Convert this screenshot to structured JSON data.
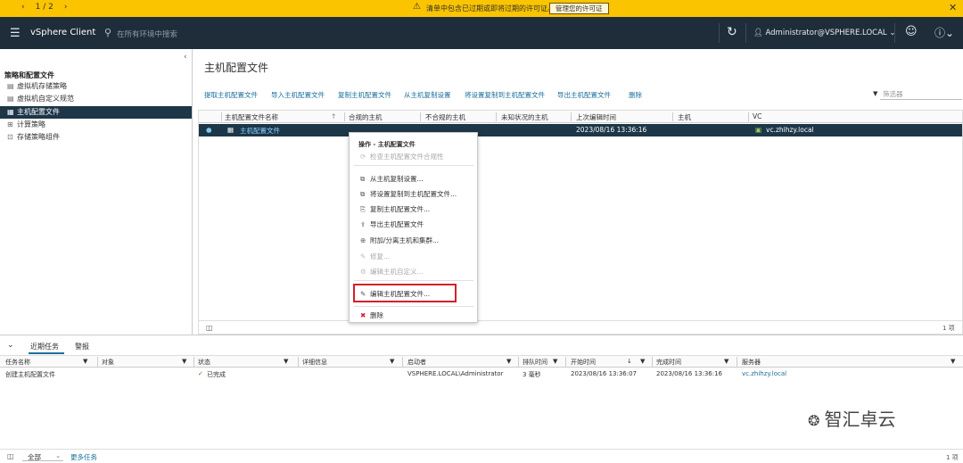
{
  "banner": {
    "pager": "1 / 2",
    "message": "清单中包含已过期或即将过期的许可证。",
    "manage_button": "管理您的许可证",
    "close": "✕"
  },
  "header": {
    "brand": "vSphere Client",
    "search_placeholder": "在所有环境中搜索",
    "user": "Administrator@VSPHERE.LOCAL"
  },
  "leftnav": {
    "section": "策略和配置文件",
    "items": [
      {
        "label": "虚拟机存储策略"
      },
      {
        "label": "虚拟机自定义规范"
      },
      {
        "label": "主机配置文件"
      },
      {
        "label": "计算策略"
      },
      {
        "label": "存储策略组件"
      }
    ]
  },
  "main": {
    "title": "主机配置文件",
    "toolbar": [
      "提取主机配置文件",
      "导入主机配置文件",
      "复制主机配置文件",
      "从主机复制设置",
      "将设置复制到主机配置文件",
      "导出主机配置文件",
      "删除"
    ],
    "filter_placeholder": "筛选器",
    "columns": [
      "主机配置文件名称",
      "合规的主机",
      "不合规的主机",
      "未知状况的主机",
      "上次编辑时间",
      "主机",
      "VC"
    ],
    "row": {
      "name": "主机配置文件",
      "edited": "2023/08/16 13:36:16",
      "vc": "vc.zhihzy.local"
    },
    "footer_count": "1 项"
  },
  "context_menu": {
    "header": "操作 - 主机配置文件",
    "items": [
      {
        "label": "检查主机配置文件合规性",
        "disabled": true
      },
      {
        "label": "从主机复制设置..."
      },
      {
        "label": "将设置复制到主机配置文件..."
      },
      {
        "label": "复制主机配置文件..."
      },
      {
        "label": "导出主机配置文件"
      },
      {
        "label": "附加/分离主机和集群..."
      },
      {
        "label": "修复...",
        "disabled": true
      },
      {
        "label": "编辑主机自定义...",
        "disabled": true
      },
      {
        "label": "编辑主机配置文件..."
      },
      {
        "label": "删除"
      }
    ]
  },
  "bottom": {
    "tabs": [
      "近期任务",
      "警报"
    ],
    "columns": [
      "任务名称",
      "对象",
      "状态",
      "详细信息",
      "启动者",
      "排队时间",
      "开始时间",
      "完成时间",
      "服务器"
    ],
    "row": {
      "task": "创建主机配置文件",
      "status": "已完成",
      "initiator": "VSPHERE.LOCAL\\Administrator",
      "queued": "3 毫秒",
      "start": "2023/08/16 13:36:07",
      "end": "2023/08/16 13:36:16",
      "server": "vc.zhihzy.local"
    },
    "filter_select": "全部",
    "more_tasks": "更多任务",
    "footer_count": "1 项"
  },
  "watermark": "智汇卓云"
}
